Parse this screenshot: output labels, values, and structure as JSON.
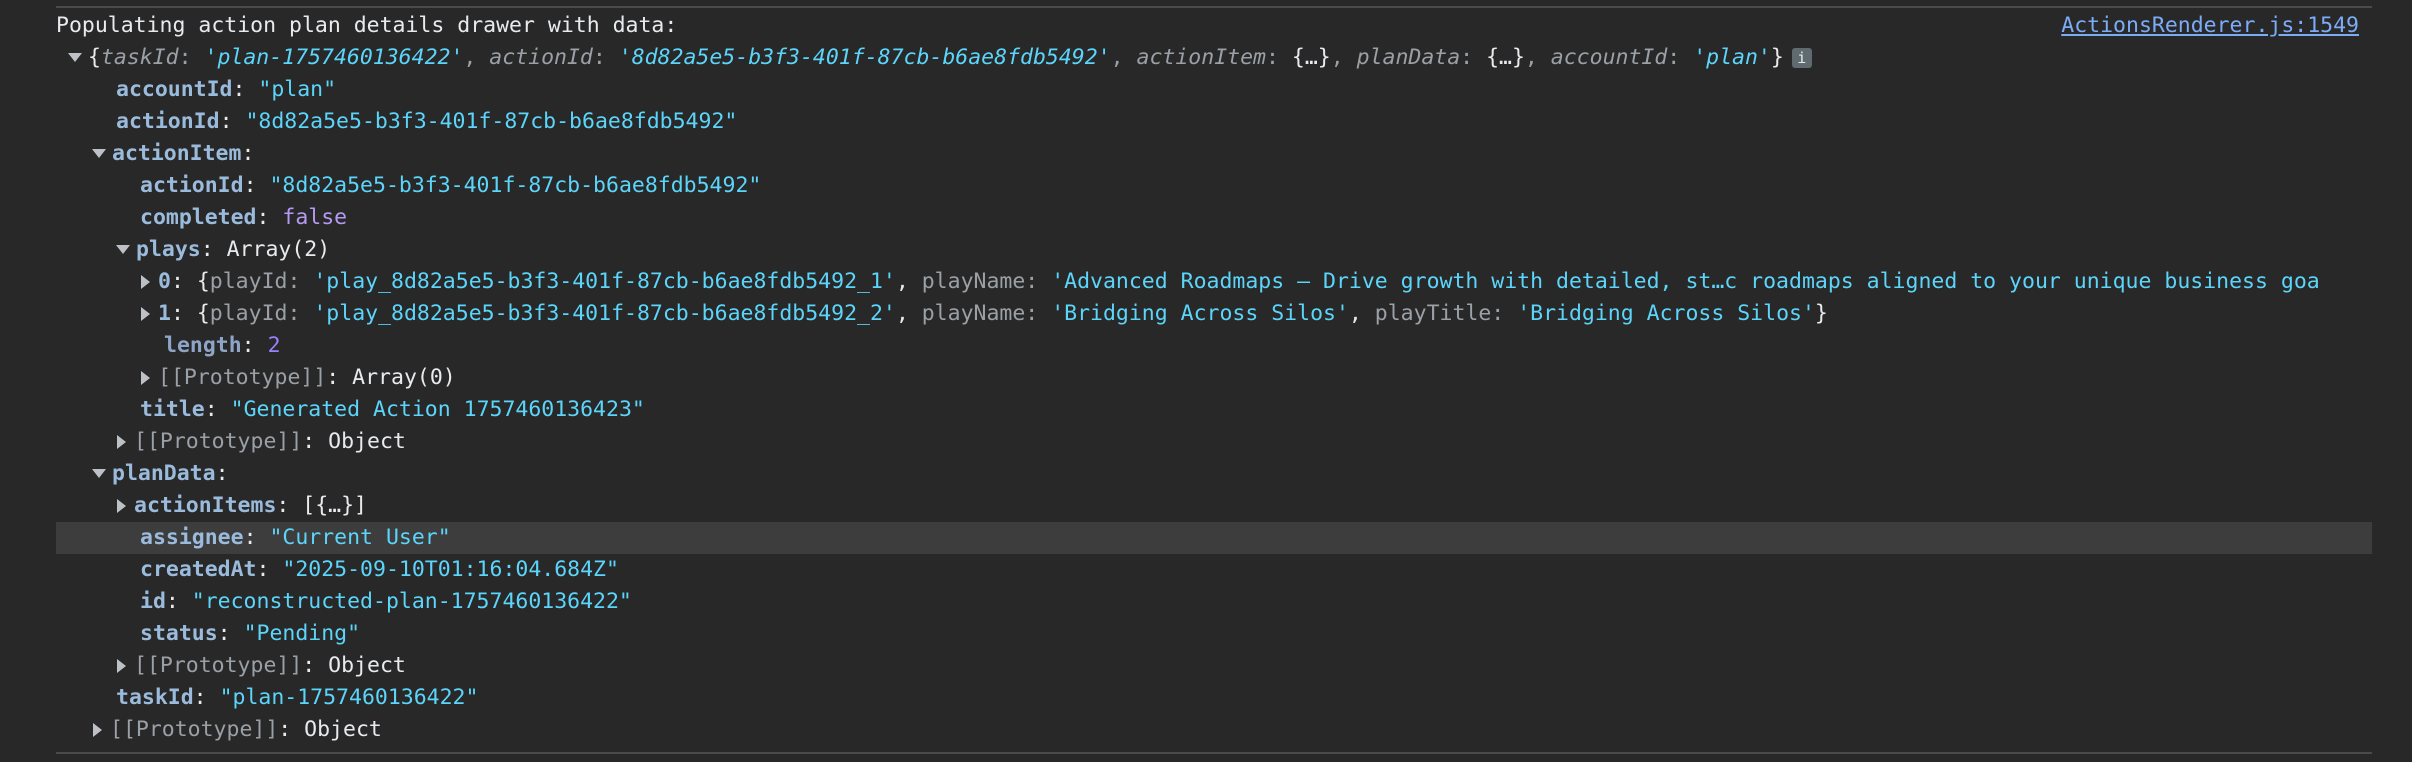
{
  "header": {
    "message": "Populating action plan details drawer with data:",
    "source_link": "ActionsRenderer.js:1549"
  },
  "summary": {
    "open_brace": "{",
    "k1": "taskId",
    "v1": "'plan-1757460136422'",
    "k2": "actionId",
    "v2": "'8d82a5e5-b3f3-401f-87cb-b6ae8fdb5492'",
    "k3": "actionItem",
    "v3": "{…}",
    "k4": "planData",
    "v4": "{…}",
    "k5": "accountId",
    "v5": "'plan'",
    "close_brace": "}",
    "info": "i"
  },
  "root": {
    "accountId_key": "accountId",
    "accountId_val": "\"plan\"",
    "actionId_key": "actionId",
    "actionId_val": "\"8d82a5e5-b3f3-401f-87cb-b6ae8fdb5492\"",
    "actionItem_key": "actionItem",
    "planData_key": "planData",
    "taskId_key": "taskId",
    "taskId_val": "\"plan-1757460136422\"",
    "proto_key": "[[Prototype]]",
    "proto_val": "Object"
  },
  "actionItem": {
    "actionId_key": "actionId",
    "actionId_val": "\"8d82a5e5-b3f3-401f-87cb-b6ae8fdb5492\"",
    "completed_key": "completed",
    "completed_val": "false",
    "plays_key": "plays",
    "plays_val": "Array(2)",
    "title_key": "title",
    "title_val": "\"Generated Action 1757460136423\"",
    "proto_key": "[[Prototype]]",
    "proto_val": "Object"
  },
  "plays": {
    "item0_index": "0",
    "item0_playId_key": "playId",
    "item0_playId_val": "'play_8d82a5e5-b3f3-401f-87cb-b6ae8fdb5492_1'",
    "item0_playName_key": "playName",
    "item0_playName_val": "'Advanced Roadmaps — Drive growth with detailed, st…c roadmaps aligned to your unique business goa",
    "item1_index": "1",
    "item1_playId_key": "playId",
    "item1_playId_val": "'play_8d82a5e5-b3f3-401f-87cb-b6ae8fdb5492_2'",
    "item1_playName_key": "playName",
    "item1_playName_val": "'Bridging Across Silos'",
    "item1_playTitle_key": "playTitle",
    "item1_playTitle_val": "'Bridging Across Silos'",
    "length_key": "length",
    "length_val": "2",
    "proto_key": "[[Prototype]]",
    "proto_val": "Array(0)"
  },
  "planData": {
    "actionItems_key": "actionItems",
    "actionItems_val": "[{…}]",
    "assignee_key": "assignee",
    "assignee_val": "\"Current User\"",
    "createdAt_key": "createdAt",
    "createdAt_val": "\"2025-09-10T01:16:04.684Z\"",
    "id_key": "id",
    "id_val": "\"reconstructed-plan-1757460136422\"",
    "status_key": "status",
    "status_val": "\"Pending\"",
    "proto_key": "[[Prototype]]",
    "proto_val": "Object"
  }
}
